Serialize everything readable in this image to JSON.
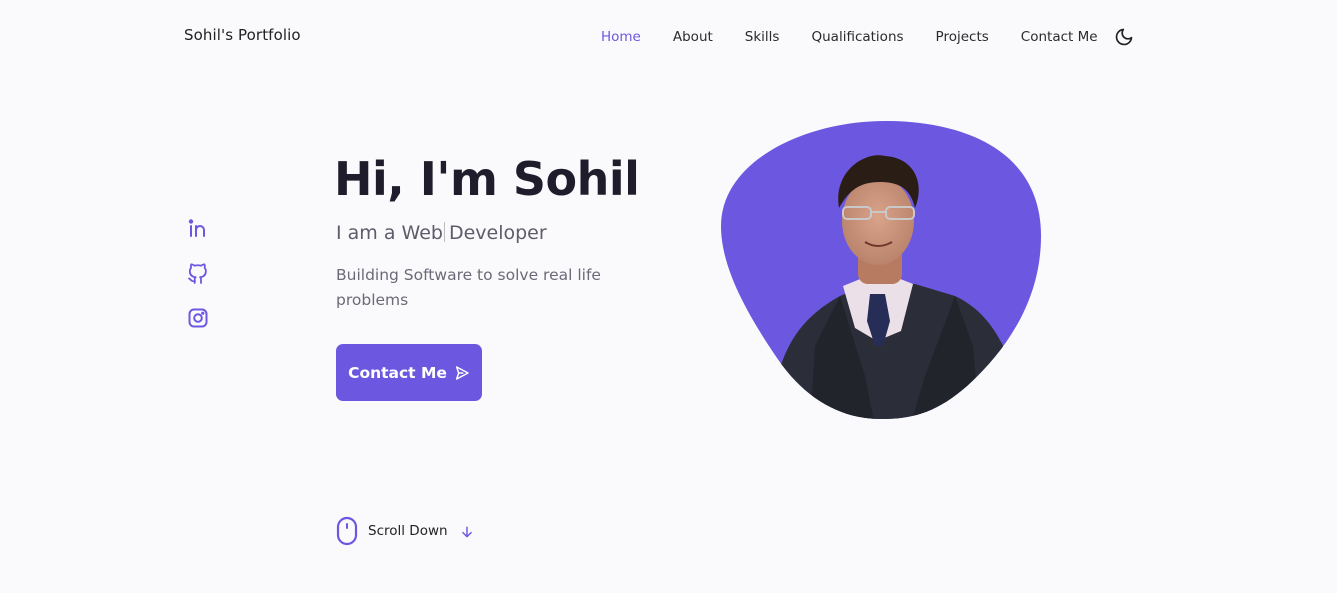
{
  "header": {
    "logo": "Sohil's Portfolio",
    "nav": [
      "Home",
      "About",
      "Skills",
      "Qualifications",
      "Projects",
      "Contact Me"
    ],
    "active_nav": "Home",
    "theme_icon": "moon-icon"
  },
  "socials": [
    {
      "icon": "linkedin-icon"
    },
    {
      "icon": "github-icon"
    },
    {
      "icon": "instagram-icon"
    }
  ],
  "hero": {
    "title": "Hi, I'm Sohil",
    "subtitle_typed": "I am a Web",
    "subtitle_rest": "Developer",
    "description": "Building Software to solve real life problems",
    "cta_label": "Contact Me",
    "cta_icon": "send-icon"
  },
  "scroll": {
    "label": "Scroll Down",
    "mouse_icon": "mouse-icon",
    "arrow_icon": "arrow-down-icon"
  },
  "colors": {
    "accent": "#6c58e0",
    "background": "#fafafc",
    "text": "#1f1d2b"
  }
}
